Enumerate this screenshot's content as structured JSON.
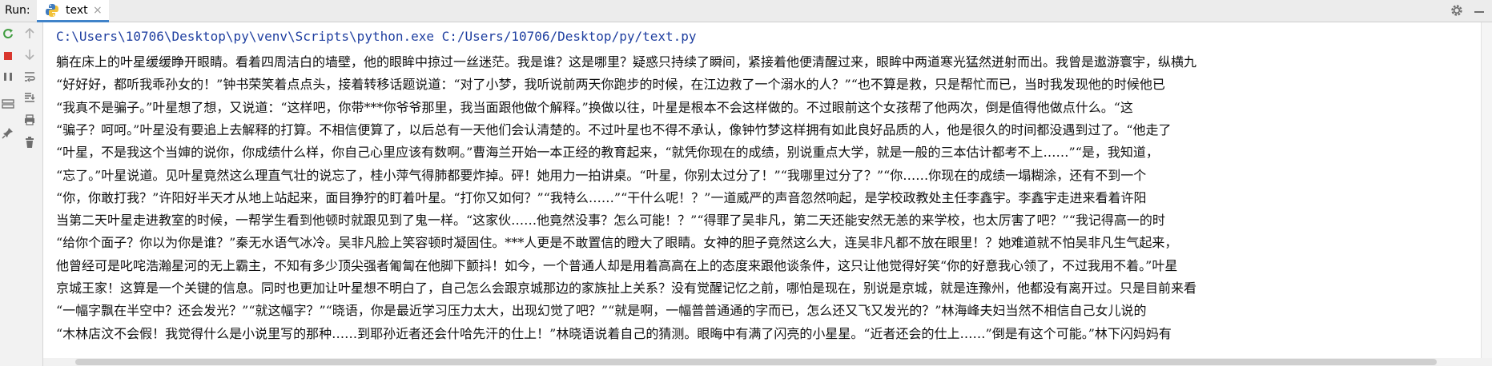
{
  "runbar": {
    "label": "Run:",
    "tab_name": "text",
    "tab_close": "×"
  },
  "console": {
    "command": "C:\\Users\\10706\\Desktop\\py\\venv\\Scripts\\python.exe C:/Users/10706/Desktop/py/text.py",
    "lines": [
      "躺在床上的叶星缓缓睁开眼睛。看着四周洁白的墙壁，他的眼眸中掠过一丝迷茫。我是谁？这是哪里？疑惑只持续了瞬间，紧接着他便清醒过来，眼眸中两道寒光猛然迸射而出。我曾是遨游寰宇，纵横九",
      "“好好好，都听我乖孙女的！”钟书荣笑着点点头，接着转移话题说道：“对了小梦，我听说前两天你跑步的时候，在江边救了一个溺水的人？”“也不算是救，只是帮忙而已，当时我发现他的时候他已",
      "“我真不是骗子。”叶星想了想，又说道：“这样吧，你带***你爷爷那里，我当面跟他做个解释。”换做以往，叶星是根本不会这样做的。不过眼前这个女孩帮了他两次，倒是值得他做点什么。“这",
      "“骗子？呵呵。”叶星没有要追上去解释的打算。不相信便算了，以后总有一天他们会认清楚的。不过叶星也不得不承认，像钟竹梦这样拥有如此良好品质的人，他是很久的时间都没遇到过了。“他走了",
      "“叶星，不是我这个当婶的说你，你成绩什么样，你自己心里应该有数啊。”曹海兰开始一本正经的教育起来，“就凭你现在的成绩，别说重点大学，就是一般的三本估计都考不上……”“是，我知道，",
      "“忘了。”叶星说道。见叶星竟然这么理直气壮的说忘了，桂小萍气得肺都要炸掉。砰！她用力一拍讲桌。“叶星，你别太过分了！”“我哪里过分了？”“你……你现在的成绩一塌糊涂，还有不到一个",
      "“你，你敢打我？”许阳好半天才从地上站起来，面目狰狞的盯着叶星。“打你又如何？”“我特么……”“干什么呢！？”一道威严的声音忽然响起，是学校政教处主任李鑫宇。李鑫宇走进来看着许阳",
      "当第二天叶星走进教室的时候，一帮学生看到他顿时就跟见到了鬼一样。“这家伙……他竟然没事？怎么可能！？”“得罪了吴非凡，第二天还能安然无恙的来学校，也太厉害了吧？”“我记得高一的时",
      "“给你个面子？你以为你是谁？”秦无水语气冰冷。吴非凡脸上笑容顿时凝固住。***人更是不敢置信的瞪大了眼睛。女神的胆子竟然这么大，连吴非凡都不放在眼里！？她难道就不怕吴非凡生气起来，",
      "他曾经可是叱咤浩瀚星河的无上霸主，不知有多少顶尖强者匍匐在他脚下颤抖！如今，一个普通人却是用着高高在上的态度来跟他谈条件，这只让他觉得好笑“你的好意我心领了，不过我用不着。”叶星",
      "京城王家！这算是一个关键的信息。同时也更加让叶星想不明白了，自己怎么会跟京城那边的家族扯上关系？没有觉醒记忆之前，哪怕是现在，别说是京城，就是连豫州，他都没有离开过。只是目前来看",
      "“一幅字飘在半空中？还会发光？”“就这幅字？”“晓语，你是最近学习压力太大，出现幻觉了吧？”“就是啊，一幅普普通通的字而已，怎么还又飞又发光的？”林海峰夫妇当然不相信自己女儿说的",
      "“木林店汶不会假！我觉得什么是小说里写的那种……到耶孙近者还会什哈先汗的仕上！”林晓语说着自己的猜测。眼晦中有满了闪亮的小星星。“近者还会的仕上……”倒是有这个可能。”林下闪妈妈有"
    ]
  },
  "colors": {
    "accent_tab": "#4083c9",
    "command_text": "#1f3fa0",
    "rerun_green": "#3e9c3e",
    "stop_red": "#d9372e"
  }
}
